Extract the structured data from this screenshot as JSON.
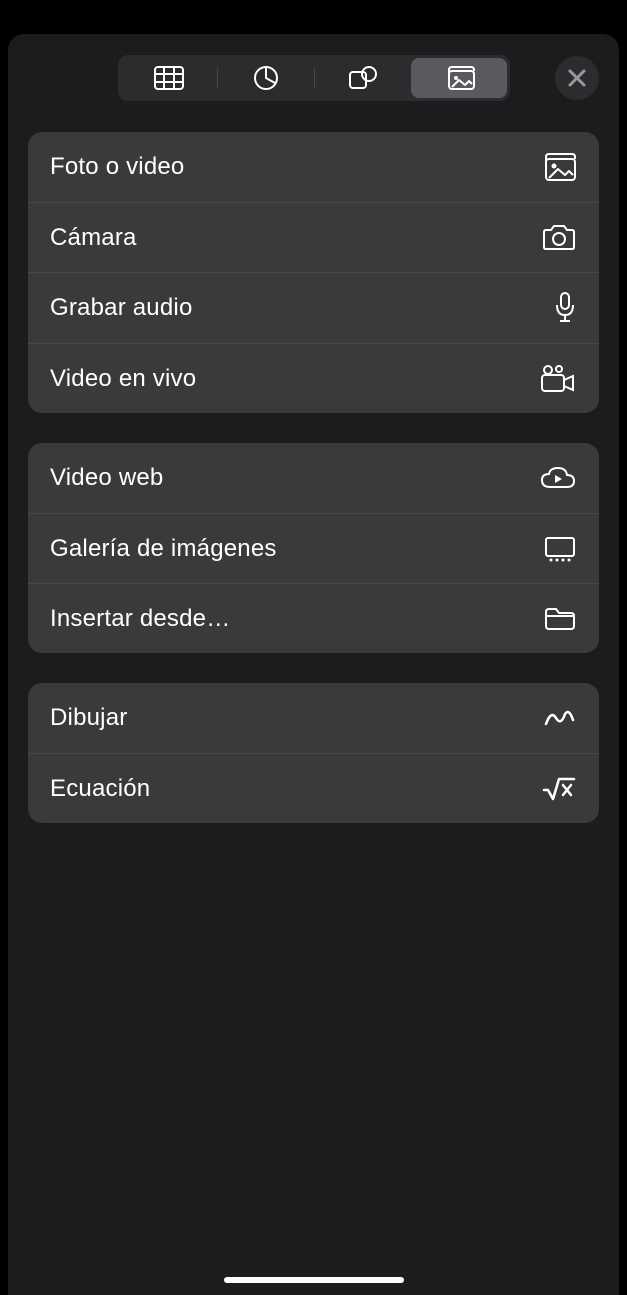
{
  "tabs": {
    "table": "table",
    "chart": "chart",
    "shape": "shape",
    "media": "media",
    "active": "media"
  },
  "groups": [
    {
      "items": [
        {
          "label": "Foto o video",
          "icon": "photo"
        },
        {
          "label": "Cámara",
          "icon": "camera"
        },
        {
          "label": "Grabar audio",
          "icon": "mic"
        },
        {
          "label": "Video en vivo",
          "icon": "videocam"
        }
      ]
    },
    {
      "items": [
        {
          "label": "Video web",
          "icon": "cloud-play"
        },
        {
          "label": "Galería de imágenes",
          "icon": "gallery"
        },
        {
          "label": "Insertar desde…",
          "icon": "folder"
        }
      ]
    },
    {
      "items": [
        {
          "label": "Dibujar",
          "icon": "scribble"
        },
        {
          "label": "Ecuación",
          "icon": "sqrt"
        }
      ]
    }
  ]
}
